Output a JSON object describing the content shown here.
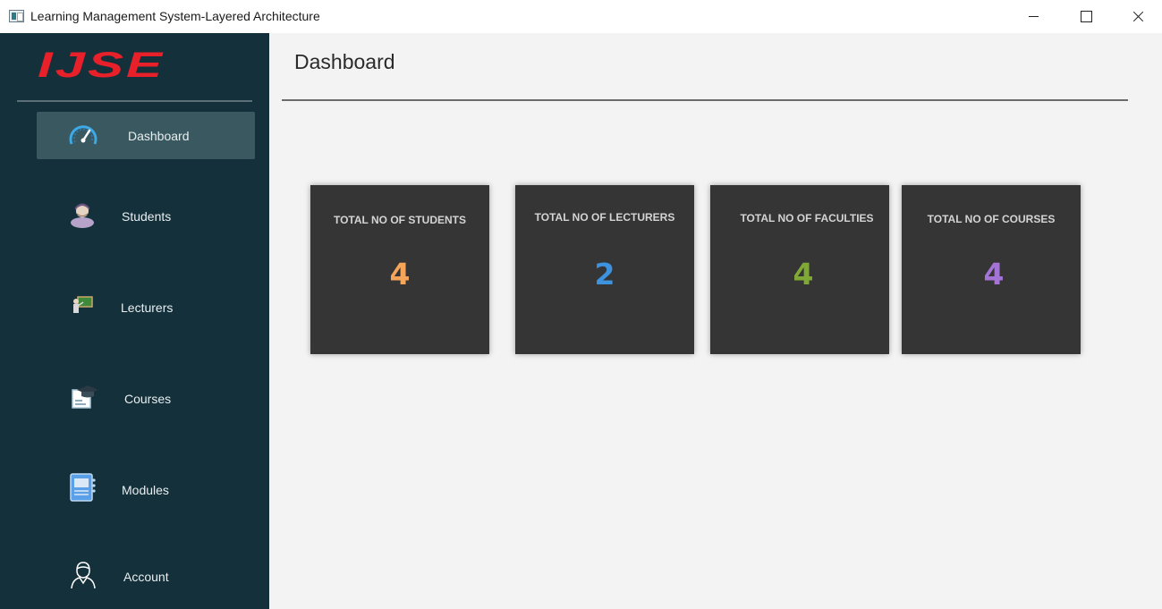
{
  "window": {
    "title": "Learning Management System-Layered Architecture"
  },
  "sidebar": {
    "logo_text": "IJSE",
    "items": [
      {
        "label": "Dashboard",
        "icon": "speedometer-icon",
        "active": true
      },
      {
        "label": "Students",
        "icon": "student-icon",
        "active": false
      },
      {
        "label": "Lecturers",
        "icon": "lecturer-icon",
        "active": false
      },
      {
        "label": "Courses",
        "icon": "graduation-cap-icon",
        "active": false
      },
      {
        "label": "Modules",
        "icon": "notebook-icon",
        "active": false
      },
      {
        "label": "Account",
        "icon": "user-outline-icon",
        "active": false
      }
    ]
  },
  "main": {
    "title": "Dashboard",
    "cards": [
      {
        "title": "TOTAL NO OF STUDENTS",
        "value": "4",
        "color": "#f4a55a"
      },
      {
        "title": "TOTAL NO OF LECTURERS",
        "value": "2",
        "color": "#3d93de"
      },
      {
        "title": "TOTAL NO OF FACULTIES",
        "value": "4",
        "color": "#7fa834"
      },
      {
        "title": "TOTAL NO OF COURSES",
        "value": "4",
        "color": "#a373d6"
      }
    ]
  },
  "colors": {
    "sidebar_bg": "#14303b",
    "sidebar_active": "#395860",
    "card_bg": "#353535",
    "brand_red": "#e8202a"
  }
}
